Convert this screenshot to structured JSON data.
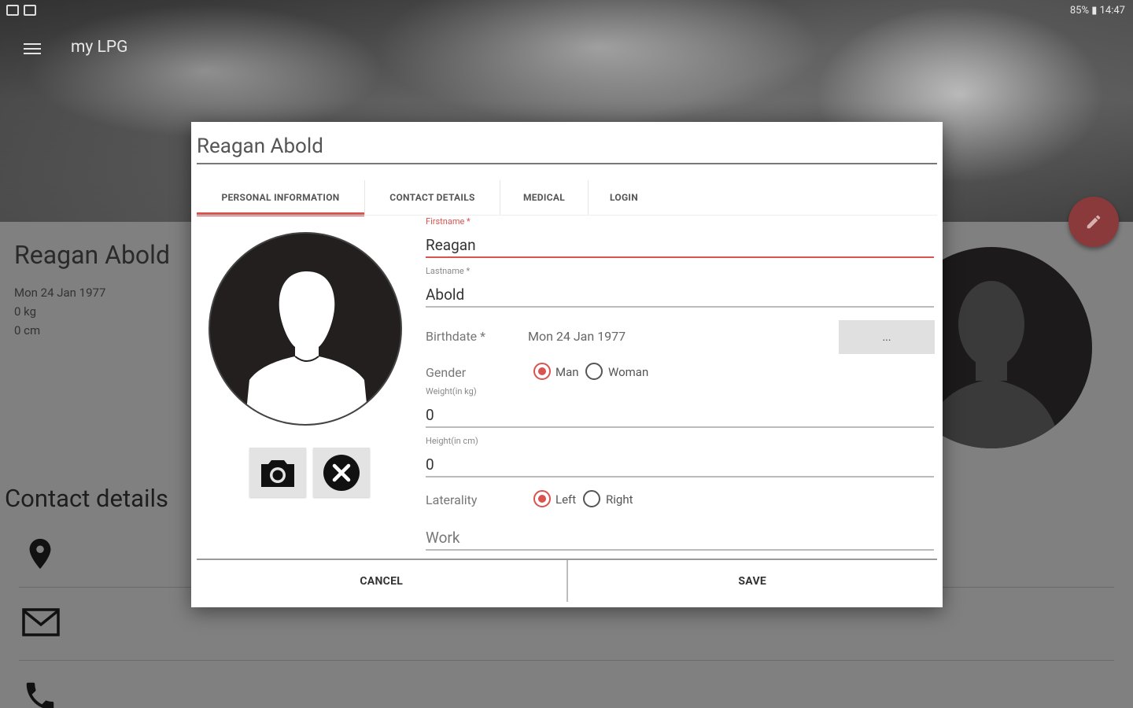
{
  "status_bar": {
    "right_text": "85% ▮ 14:47"
  },
  "app_bar": {
    "title": "my LPG"
  },
  "profile": {
    "name": "Reagan Abold",
    "birthdate": "Mon 24 Jan 1977",
    "weight": "0 kg",
    "height": "0 cm"
  },
  "contact_section": {
    "heading": "Contact details"
  },
  "dialog": {
    "title": "Reagan Abold",
    "tabs": [
      {
        "label": "PERSONAL INFORMATION",
        "active": true
      },
      {
        "label": "CONTACT DETAILS",
        "active": false
      },
      {
        "label": "MEDICAL",
        "active": false
      },
      {
        "label": "LOGIN",
        "active": false
      }
    ],
    "firstname": {
      "label": "Firstname *",
      "value": "Reagan"
    },
    "lastname": {
      "label": "Lastname *",
      "value": "Abold"
    },
    "birthdate": {
      "label": "Birthdate *",
      "value": "Mon 24 Jan 1977",
      "button": "..."
    },
    "gender": {
      "label": "Gender",
      "options": [
        "Man",
        "Woman"
      ],
      "selected": "Man"
    },
    "weight": {
      "label": "Weight(in kg)",
      "value": "0"
    },
    "height": {
      "label": "Height(in cm)",
      "value": "0"
    },
    "laterality": {
      "label": "Laterality",
      "options": [
        "Left",
        "Right"
      ],
      "selected": "Left"
    },
    "work": {
      "placeholder": "Work"
    },
    "cancel_label": "CANCEL",
    "save_label": "SAVE"
  },
  "colors": {
    "accent": "#d9534f",
    "fab": "#8a3a3a",
    "avatar": "#231f1f"
  }
}
